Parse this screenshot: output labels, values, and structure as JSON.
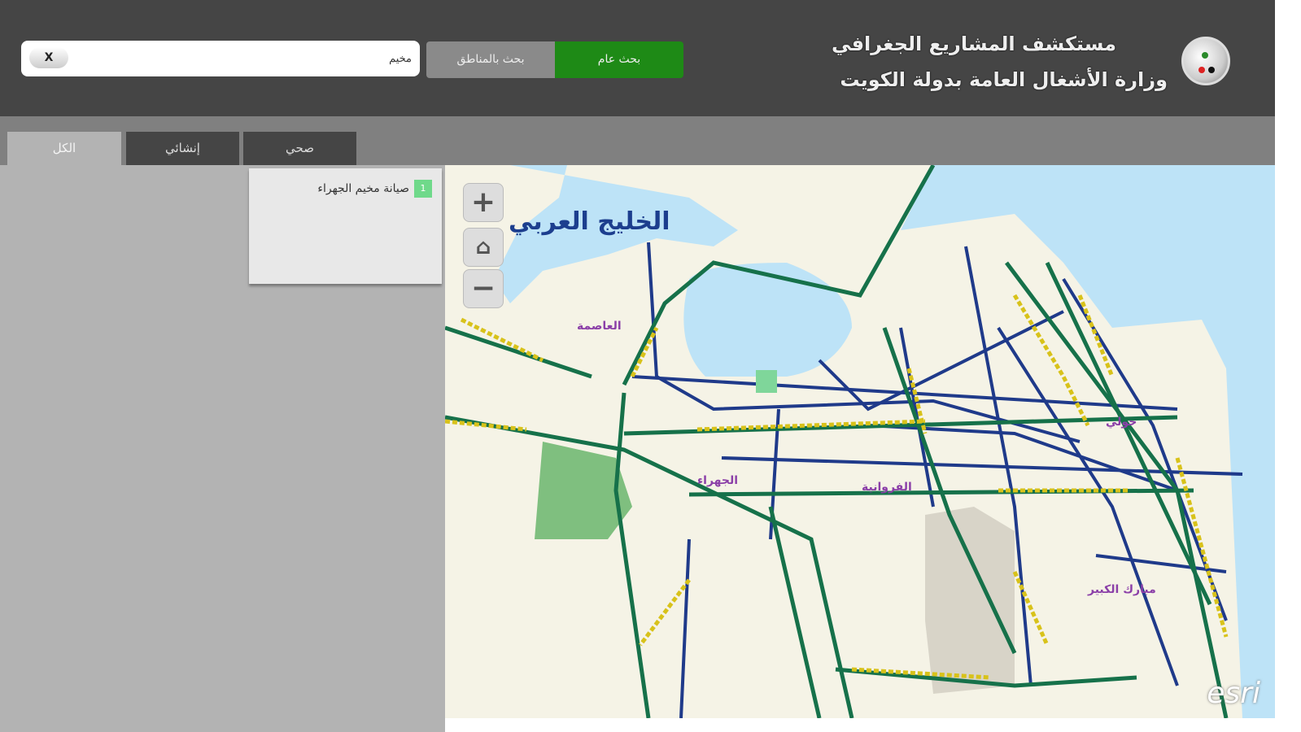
{
  "header": {
    "title_line1": "مستكشف المشاريع الجغرافي",
    "title_line2": "وزارة الأشغال العامة بدولة الكويت",
    "logo_icon": "ministry-logo"
  },
  "search": {
    "value": "مخيم",
    "clear_label": "X",
    "by_area_label": "بحث بالمناطق",
    "general_label": "بحث عام",
    "general_color": "#1e8a16"
  },
  "tabs": [
    {
      "label": "الكل",
      "active": true
    },
    {
      "label": "إنشائي"
    },
    {
      "label": "صحي"
    }
  ],
  "results": [
    {
      "number": "1",
      "label": "صيانة مخيم الجهراء"
    }
  ],
  "map": {
    "zoom_in": "+",
    "home_icon": "home-icon",
    "zoom_out": "−",
    "sea_label": "الخليج العربي",
    "labels": [
      "العاصمة",
      "الجهراء",
      "الفروانية",
      "حولي",
      "مبارك الكبير"
    ],
    "attribution": "esri",
    "colors": {
      "sea": "#bde3f7",
      "land": "#f5f3e6",
      "major_road": "#16714a",
      "road": "#1f3a8a",
      "project": "#d8c21a"
    }
  }
}
